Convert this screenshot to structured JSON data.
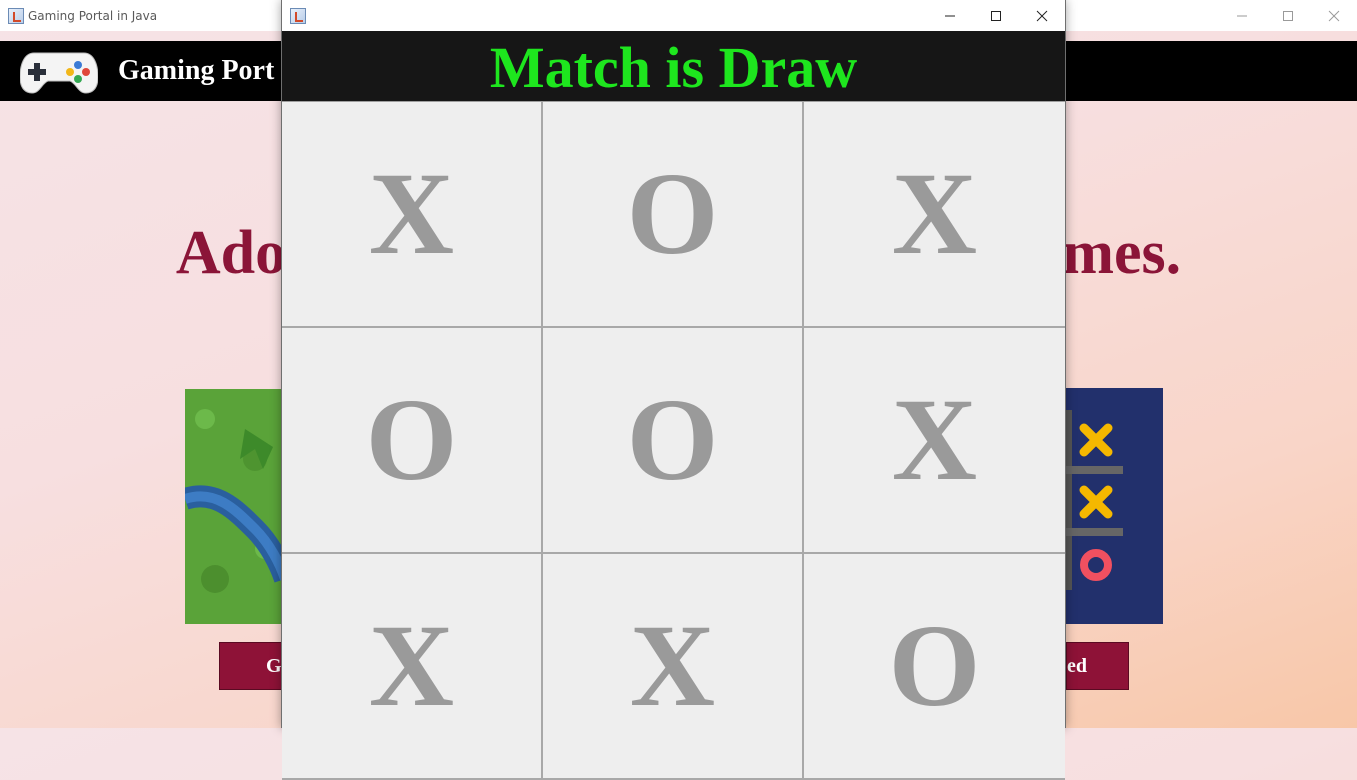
{
  "background_window": {
    "title": "Gaming Portal in Java",
    "controls": {
      "minimize_icon": "minimize-icon",
      "maximize_icon": "maximize-icon",
      "close_icon": "close-icon"
    },
    "navbar": {
      "logo_icon": "gamepad-icon",
      "brand_text": "Gaming Port"
    },
    "headline": {
      "left": "Adorn",
      "right": "Games."
    },
    "buttons": {
      "left_label": "G",
      "right_label": "ed"
    }
  },
  "dialog": {
    "title": "",
    "controls": {
      "minimize_glyph": "—",
      "maximize_glyph": "☐",
      "close_glyph": "✕"
    },
    "status_text": "Match is Draw",
    "board": [
      "X",
      "O",
      "X",
      "O",
      "O",
      "X",
      "X",
      "X",
      "O"
    ]
  },
  "colors": {
    "status_text": "#1ee61e",
    "status_bar": "#161616",
    "mark": "#9a9a9a",
    "headline": "#8b1538",
    "button": "#8e1237"
  }
}
